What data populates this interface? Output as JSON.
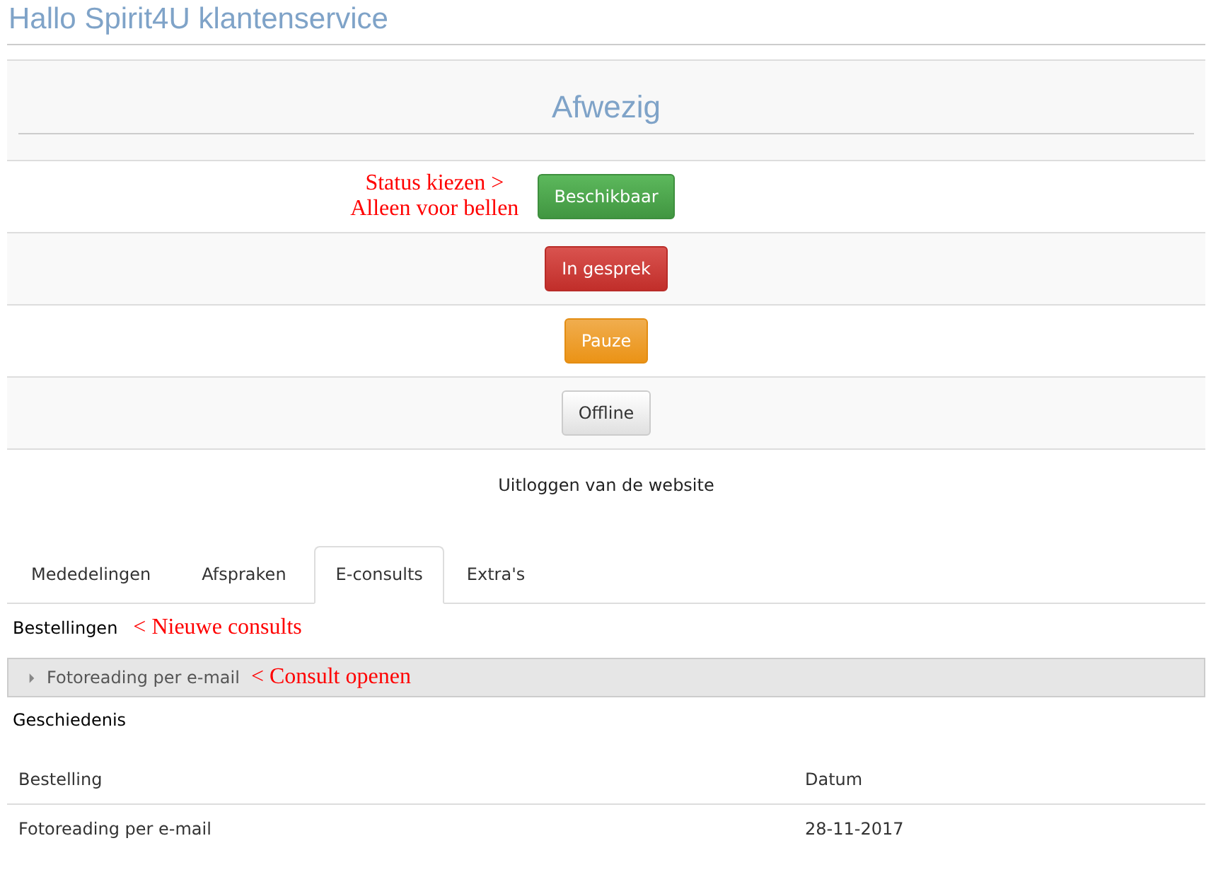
{
  "greeting": "Hallo Spirit4U klantenservice",
  "status": {
    "current": "Afwezig",
    "note_lines": [
      "Status kiezen >",
      "Alleen voor bellen"
    ],
    "buttons": [
      {
        "label": "Beschikbaar",
        "kind": "success"
      },
      {
        "label": "In gesprek",
        "kind": "danger"
      },
      {
        "label": "Pauze",
        "kind": "warning"
      },
      {
        "label": "Offline",
        "kind": "default"
      }
    ]
  },
  "logout_link": "Uitloggen van de website",
  "tabs": [
    {
      "label": "Mededelingen",
      "selected": false
    },
    {
      "label": "Afspraken",
      "selected": false
    },
    {
      "label": "E-consults",
      "selected": true
    },
    {
      "label": "Extra's",
      "selected": false
    }
  ],
  "orders": {
    "heading": "Bestellingen",
    "note": "< Nieuwe consults",
    "items": [
      {
        "label": "Fotoreading per e-mail",
        "note": "< Consult openen",
        "expanded": false
      }
    ]
  },
  "history": {
    "heading": "Geschiedenis",
    "columns": [
      "Bestelling",
      "Datum"
    ],
    "rows": [
      [
        "Fotoreading per e-mail",
        "28-11-2017"
      ]
    ]
  }
}
